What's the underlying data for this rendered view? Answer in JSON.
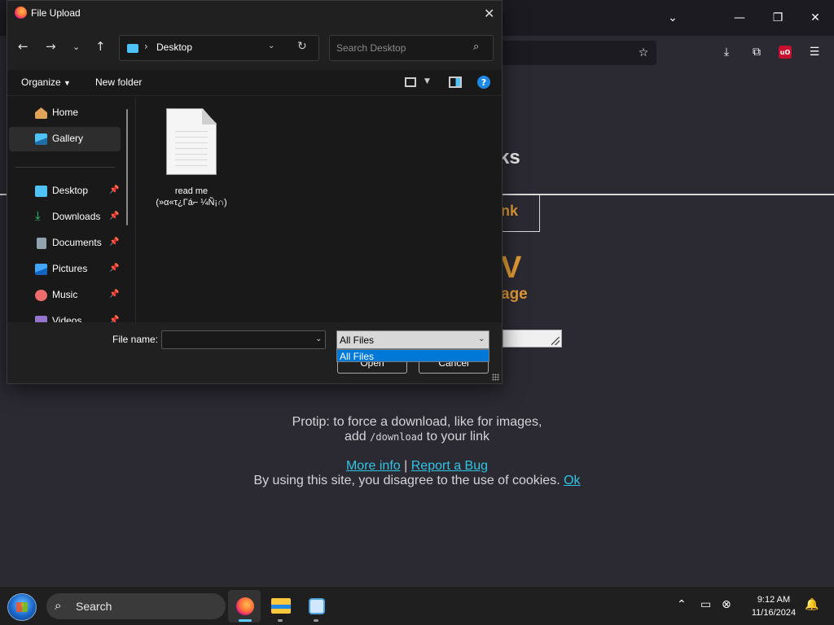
{
  "dialog": {
    "title": "File Upload",
    "nav": {
      "address": "Desktop",
      "search_placeholder": "Search Desktop"
    },
    "commands": {
      "organize": "Organize",
      "new_folder": "New folder",
      "help": "?"
    },
    "sidebar": [
      {
        "label": "Home",
        "pinned": false,
        "icon": "home-icon",
        "color": "#e0a458"
      },
      {
        "label": "Gallery",
        "pinned": false,
        "icon": "gallery-icon",
        "color": "#4fc3f7",
        "selected": true
      },
      {
        "label": "Desktop",
        "pinned": true,
        "icon": "desktop-folder-icon",
        "color": "#4fc3f7"
      },
      {
        "label": "Downloads",
        "pinned": true,
        "icon": "downloads-icon",
        "color": "#2ecc71"
      },
      {
        "label": "Documents",
        "pinned": true,
        "icon": "documents-icon",
        "color": "#90a4ae"
      },
      {
        "label": "Pictures",
        "pinned": true,
        "icon": "pictures-icon",
        "color": "#42a5f5"
      },
      {
        "label": "Music",
        "pinned": true,
        "icon": "music-icon",
        "color": "#ef6c6c"
      },
      {
        "label": "Videos",
        "pinned": true,
        "icon": "videos-icon",
        "color": "#9575cd"
      }
    ],
    "files": [
      {
        "name_line1": "read me",
        "name_line2": "(»α«τ¿Γá⌐ ¼Ñ¡∩)"
      }
    ],
    "bottom": {
      "file_name_label": "File name:",
      "file_name_value": "",
      "file_type_selected": "All Files",
      "file_type_options": [
        "All Files"
      ],
      "open_label": "Open",
      "cancel_label": "Cancel"
    }
  },
  "page": {
    "title_fragment": "ks",
    "link_fragment": "nk",
    "big_fragment": "V",
    "sub_fragment": "age",
    "protip_line1": "Protip: to force a download, like for images,",
    "protip_add": "add",
    "protip_code": "/download",
    "protip_tail": "to your link",
    "more_info": "More info",
    "separator": "|",
    "report_bug": "Report a Bug",
    "cookie_text": "By using this site, you disagree to the use of cookies.",
    "cookie_ok": "Ok",
    "colors": {
      "accent": "#e09a34",
      "link": "#2ec5e6"
    }
  },
  "taskbar": {
    "search_label": "Search",
    "time": "9:12 AM",
    "date": "11/16/2024"
  }
}
